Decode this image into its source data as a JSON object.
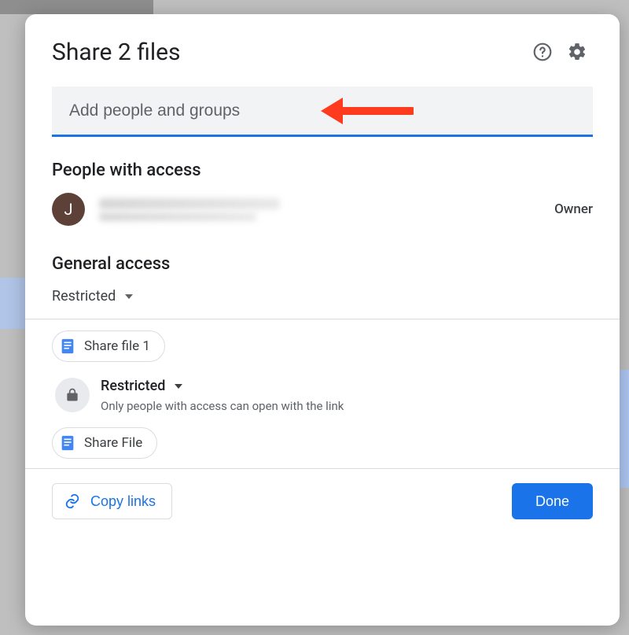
{
  "dialog": {
    "title": "Share 2 files"
  },
  "input": {
    "placeholder": "Add people and groups",
    "value": ""
  },
  "people_section": {
    "heading": "People with access",
    "owner": {
      "avatar_initial": "J",
      "role": "Owner"
    }
  },
  "general_access": {
    "heading": "General access",
    "selected": "Restricted"
  },
  "files": [
    {
      "chip_label": "Share file 1",
      "access": {
        "label": "Restricted",
        "description": "Only people with access can open with the link"
      }
    },
    {
      "chip_label": "Share File"
    }
  ],
  "footer": {
    "copy_label": "Copy links",
    "done_label": "Done"
  }
}
